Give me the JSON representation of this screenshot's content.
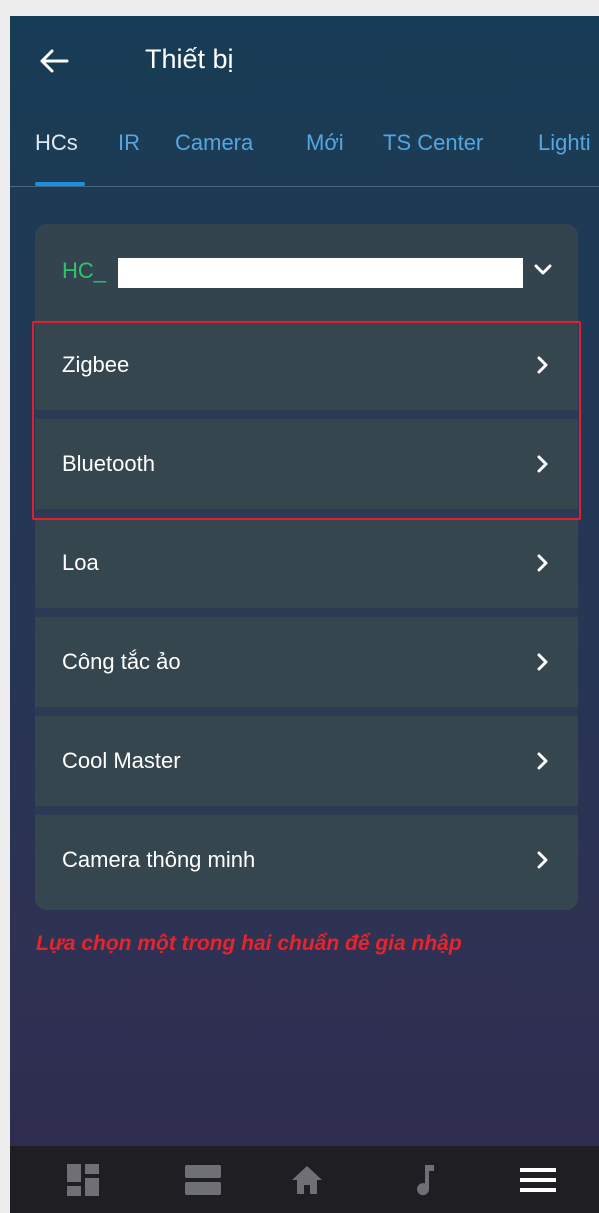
{
  "header": {
    "title": "Thiết bị",
    "back_icon": "arrow-left-icon"
  },
  "tabs": [
    {
      "label": "HCs",
      "active": true
    },
    {
      "label": "IR",
      "active": false
    },
    {
      "label": "Camera",
      "active": false
    },
    {
      "label": "Mới",
      "active": false
    },
    {
      "label": "TS Center",
      "active": false
    },
    {
      "label": "Lighti",
      "active": false
    }
  ],
  "hc": {
    "label": "HC_",
    "chevron_icon": "chevron-down-icon"
  },
  "items": [
    {
      "label": "Zigbee",
      "icon": "chevron-right-icon"
    },
    {
      "label": "Bluetooth",
      "icon": "chevron-right-icon"
    },
    {
      "label": "Loa",
      "icon": "chevron-right-icon"
    },
    {
      "label": "Công tắc ảo",
      "icon": "chevron-right-icon"
    },
    {
      "label": "Cool Master",
      "icon": "chevron-right-icon"
    },
    {
      "label": "Camera thông minh",
      "icon": "chevron-right-icon"
    }
  ],
  "annotation": {
    "note": "Lựa chọn một trong hai chuẩn để gia nhập",
    "color": "#e8232b"
  },
  "bottom_nav": [
    {
      "icon": "dashboard-icon"
    },
    {
      "icon": "rooms-icon"
    },
    {
      "icon": "home-icon"
    },
    {
      "icon": "music-icon"
    },
    {
      "icon": "menu-icon"
    }
  ],
  "colors": {
    "accent": "#1e8fe0",
    "hc_green": "#2fc46b",
    "card": "#34444f"
  }
}
